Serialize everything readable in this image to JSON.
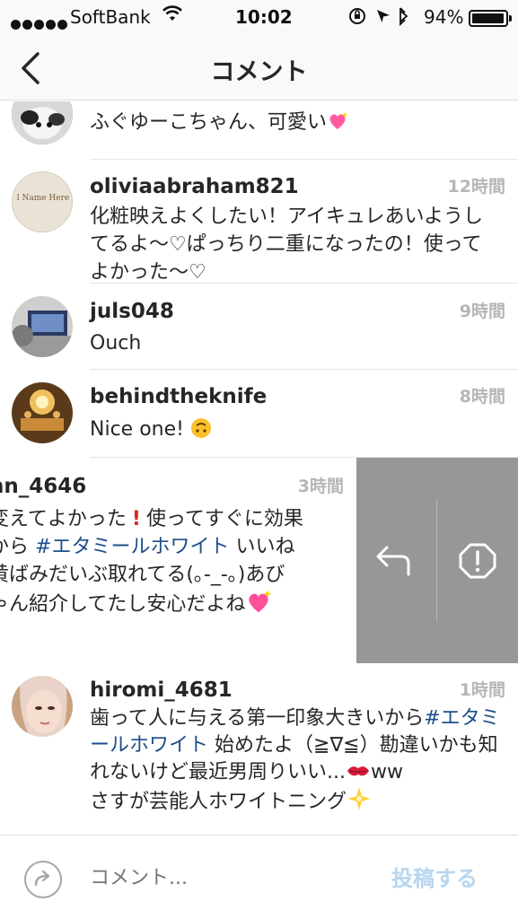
{
  "status_bar": {
    "carrier": "SoftBank",
    "time": "10:02",
    "battery": "94%"
  },
  "header": {
    "title": "コメント"
  },
  "comments": [
    {
      "username": "",
      "text": "ふぐゆーこちゃん、可愛い",
      "time": ""
    },
    {
      "username": "oliviaabraham821",
      "text": "化粧映えよくしたい！アイキュレあいようしてるよ〜♡ぱっちり二重になったの！使ってよかった〜♡",
      "time": "12時間",
      "avatar_text": "l Name Here"
    },
    {
      "username": "juls048",
      "text": "Ouch",
      "time": "9時間"
    },
    {
      "username": "behindtheknife",
      "text": "Nice one!",
      "time": "8時間"
    },
    {
      "username": "n_4646",
      "line1": "変えてよかった",
      "line1b": "使ってすぐに効果",
      "line2a": "から",
      "line2_hashtag": "#エタミールホワイト",
      "line2b": "いいね",
      "line3": "黄ばみだいぶ取れてる(｡-_-｡)あび",
      "line4": "ゃん紹介してたし安心だよね",
      "time": "3時間"
    },
    {
      "username": "hiromi_4681",
      "text_a": "歯って人に与える第一印象大きいから",
      "hashtag": "#エタミールホワイト",
      "text_b": "始めたよ（≧∇≦）勘違いかも知れないけど最近男周りいい...",
      "text_c": "ww",
      "text_d": "さすが芸能人ホワイトニング",
      "time": "1時間"
    }
  ],
  "composer": {
    "placeholder": "コメント...",
    "post_label": "投稿する"
  },
  "colors": {
    "hashtag": "#1d4f8a",
    "timestamp": "#b6b6b6",
    "swipe_bg": "#979797",
    "post_disabled": "#b7d6f0"
  }
}
